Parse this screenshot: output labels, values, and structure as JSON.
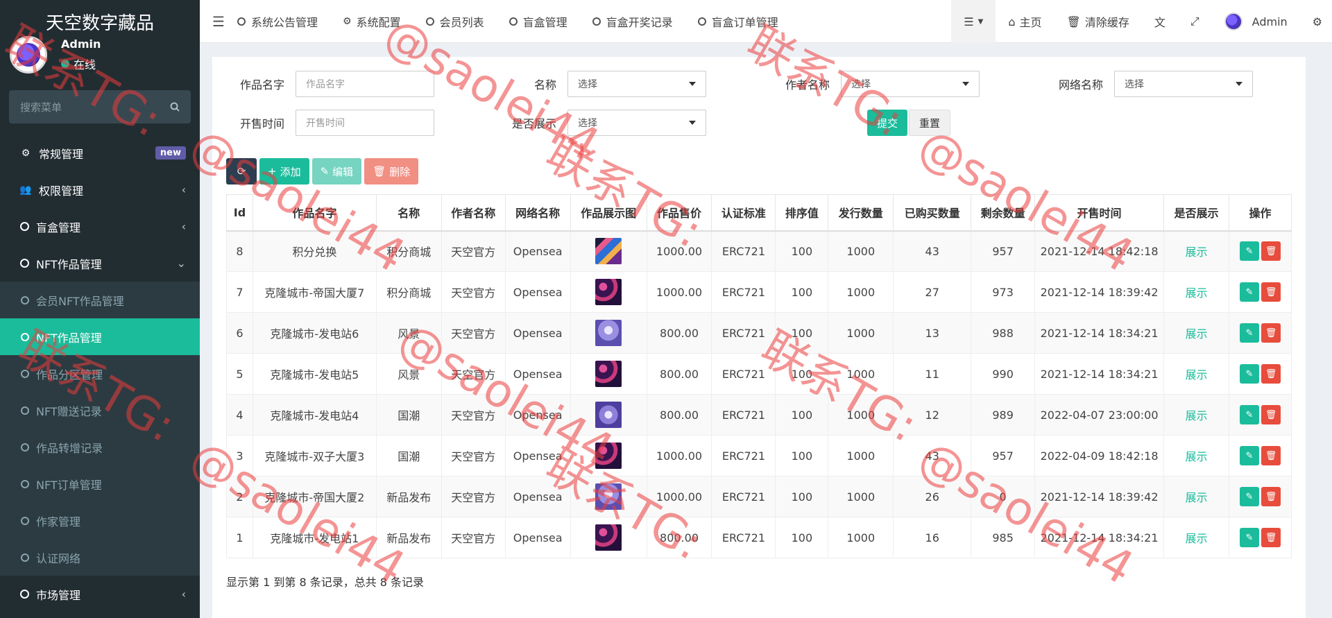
{
  "app": {
    "title": "天空数字藏品"
  },
  "user": {
    "name": "Admin",
    "status": "在线"
  },
  "sidebar": {
    "search_placeholder": "搜索菜单",
    "items": [
      {
        "label": "常规管理",
        "icon": "cogs-icon",
        "badge": "new"
      },
      {
        "label": "权限管理",
        "icon": "users-icon"
      },
      {
        "label": "盲盒管理",
        "icon": "circle-icon"
      },
      {
        "label": "NFT作品管理",
        "icon": "circle-icon"
      }
    ],
    "nft_sub": [
      "会员NFT作品管理",
      "NFT作品管理",
      "作品分区管理",
      "NFT赠送记录",
      "作品转增记录",
      "NFT订单管理",
      "作家管理",
      "认证网络"
    ],
    "market": "市场管理"
  },
  "topbar": {
    "tabs": [
      "系统公告管理",
      "系统配置",
      "会员列表",
      "盲盒管理",
      "盲盒开奖记录",
      "盲盒订单管理"
    ],
    "home": "主页",
    "clear_cache": "清除缓存",
    "admin": "Admin"
  },
  "filters": {
    "work_name_label": "作品名字",
    "work_name_placeholder": "作品名字",
    "name_label": "名称",
    "name_value": "选择",
    "author_label": "作者名称",
    "author_value": "选择",
    "network_label": "网络名称",
    "network_value": "选择",
    "sale_time_label": "开售时间",
    "sale_time_placeholder": "开售时间",
    "show_label": "是否展示",
    "show_value": "选择",
    "submit": "提交",
    "reset": "重置"
  },
  "toolbar": {
    "add": "添加",
    "edit": "编辑",
    "delete": "删除"
  },
  "table": {
    "headers": [
      "Id",
      "作品名字",
      "名称",
      "作者名称",
      "网络名称",
      "作品展示图",
      "作品售价",
      "认证标准",
      "排序值",
      "发行数量",
      "已购买数量",
      "剩余数量",
      "开售时间",
      "是否展示",
      "操作"
    ],
    "rows": [
      {
        "id": "8",
        "work": "积分兑换",
        "name": "积分商城",
        "author": "天空官方",
        "network": "Opensea",
        "price": "1000.00",
        "standard": "ERC721",
        "sort": "100",
        "issued": "1000",
        "bought": "43",
        "remain": "957",
        "time": "2021-12-14 18:42:18",
        "show": "展示"
      },
      {
        "id": "7",
        "work": "克隆城市-帝国大厦7",
        "name": "积分商城",
        "author": "天空官方",
        "network": "Opensea",
        "price": "1000.00",
        "standard": "ERC721",
        "sort": "100",
        "issued": "1000",
        "bought": "27",
        "remain": "973",
        "time": "2021-12-14 18:39:42",
        "show": "展示"
      },
      {
        "id": "6",
        "work": "克隆城市-发电站6",
        "name": "风景",
        "author": "天空官方",
        "network": "Opensea",
        "price": "800.00",
        "standard": "ERC721",
        "sort": "100",
        "issued": "1000",
        "bought": "13",
        "remain": "988",
        "time": "2021-12-14 18:34:21",
        "show": "展示"
      },
      {
        "id": "5",
        "work": "克隆城市-发电站5",
        "name": "风景",
        "author": "天空官方",
        "network": "Opensea",
        "price": "800.00",
        "standard": "ERC721",
        "sort": "100",
        "issued": "1000",
        "bought": "11",
        "remain": "990",
        "time": "2021-12-14 18:34:21",
        "show": "展示"
      },
      {
        "id": "4",
        "work": "克隆城市-发电站4",
        "name": "国潮",
        "author": "天空官方",
        "network": "Opensea",
        "price": "800.00",
        "standard": "ERC721",
        "sort": "100",
        "issued": "1000",
        "bought": "12",
        "remain": "989",
        "time": "2022-04-07 23:00:00",
        "show": "展示"
      },
      {
        "id": "3",
        "work": "克隆城市-双子大厦3",
        "name": "国潮",
        "author": "天空官方",
        "network": "Opensea",
        "price": "1000.00",
        "standard": "ERC721",
        "sort": "100",
        "issued": "1000",
        "bought": "43",
        "remain": "957",
        "time": "2022-04-09 18:42:18",
        "show": "展示"
      },
      {
        "id": "2",
        "work": "克隆城市-帝国大厦2",
        "name": "新品发布",
        "author": "天空官方",
        "network": "Opensea",
        "price": "1000.00",
        "standard": "ERC721",
        "sort": "100",
        "issued": "1000",
        "bought": "26",
        "remain": "0",
        "time": "2021-12-14 18:39:42",
        "show": "展示"
      },
      {
        "id": "1",
        "work": "克隆城市-发电站1",
        "name": "新品发布",
        "author": "天空官方",
        "network": "Opensea",
        "price": "800.00",
        "standard": "ERC721",
        "sort": "100",
        "issued": "1000",
        "bought": "16",
        "remain": "985",
        "time": "2021-12-14 18:34:21",
        "show": "展示"
      }
    ]
  },
  "pager": {
    "text": "显示第 1 到第 8 条记录，总共 8 条记录"
  },
  "watermark": {
    "line1": "联系TG:",
    "line2": "@saolei44"
  },
  "colors": {
    "accent": "#1bbc9b",
    "sidebar": "#222d32",
    "danger": "#e74c3c"
  }
}
